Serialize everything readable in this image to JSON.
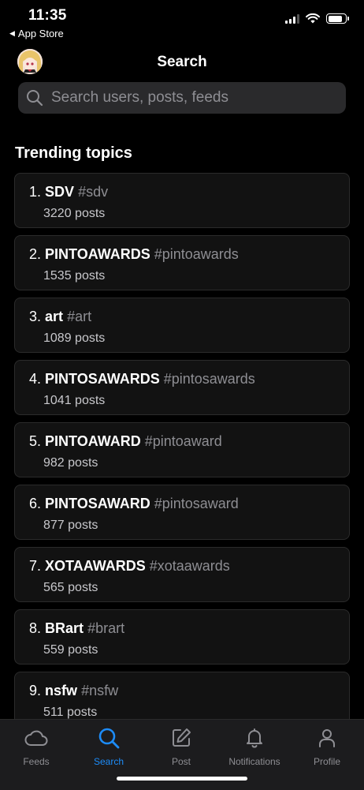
{
  "status_bar": {
    "time": "11:35",
    "back_app": "App Store"
  },
  "header": {
    "title": "Search"
  },
  "search": {
    "placeholder": "Search users, posts, feeds"
  },
  "section": {
    "title": "Trending topics"
  },
  "topics": [
    {
      "rank": "1.",
      "name": "SDV",
      "tag": "#sdv",
      "count": "3220 posts"
    },
    {
      "rank": "2.",
      "name": "PINTOAWARDS",
      "tag": "#pintoawards",
      "count": "1535 posts"
    },
    {
      "rank": "3.",
      "name": "art",
      "tag": "#art",
      "count": "1089 posts"
    },
    {
      "rank": "4.",
      "name": "PINTOSAWARDS",
      "tag": "#pintosawards",
      "count": "1041 posts"
    },
    {
      "rank": "5.",
      "name": "PINTOAWARD",
      "tag": "#pintoaward",
      "count": "982 posts"
    },
    {
      "rank": "6.",
      "name": "PINTOSAWARD",
      "tag": "#pintosaward",
      "count": "877 posts"
    },
    {
      "rank": "7.",
      "name": "XOTAAWARDS",
      "tag": "#xotaawards",
      "count": "565 posts"
    },
    {
      "rank": "8.",
      "name": "BRart",
      "tag": "#brart",
      "count": "559 posts"
    },
    {
      "rank": "9.",
      "name": "nsfw",
      "tag": "#nsfw",
      "count": "511 posts"
    }
  ],
  "tabs": [
    {
      "label": "Feeds",
      "icon": "cloud-icon"
    },
    {
      "label": "Search",
      "icon": "search-icon",
      "active": true
    },
    {
      "label": "Post",
      "icon": "compose-icon"
    },
    {
      "label": "Notifications",
      "icon": "bell-icon"
    },
    {
      "label": "Profile",
      "icon": "person-icon"
    }
  ],
  "colors": {
    "accent": "#1d8cf8",
    "background": "#000000",
    "card": "#121212",
    "muted": "#8e8e93"
  }
}
